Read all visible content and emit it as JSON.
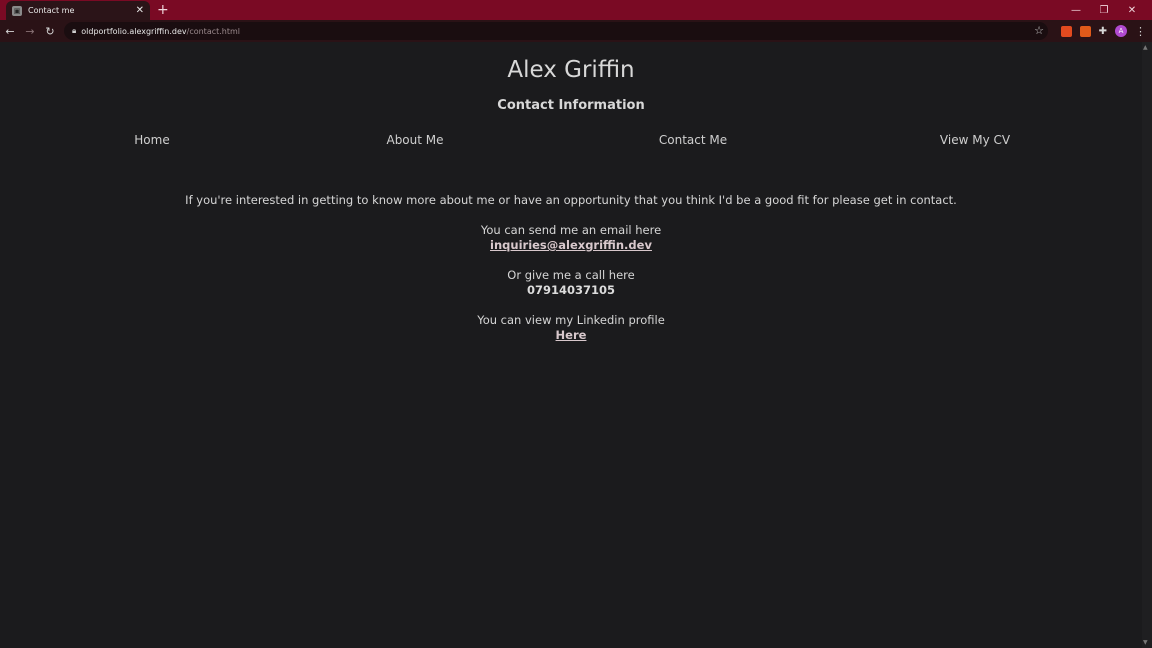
{
  "browser": {
    "tab_title": "Contact me",
    "url_host": "oldportfolio.alexgriffin.dev",
    "url_path": "/contact.html",
    "profile_initial": "A",
    "accent_color": "#7a0a24"
  },
  "site": {
    "title": "Alex Griffin",
    "subtitle": "Contact Information",
    "nav": [
      {
        "label": "Home"
      },
      {
        "label": "About Me"
      },
      {
        "label": "Contact Me"
      },
      {
        "label": "View My CV"
      }
    ]
  },
  "contact": {
    "intro": "If you're interested in getting to know more about me or have an opportunity that you think I'd be a good fit for please get in contact.",
    "email_label": "You can send me an email here",
    "email": "inquiries@alexgriffin.dev",
    "phone_label": "Or give me a call here",
    "phone": "07914037105",
    "linkedin_label": "You can view my Linkedin profile",
    "linkedin_link": "Here"
  }
}
